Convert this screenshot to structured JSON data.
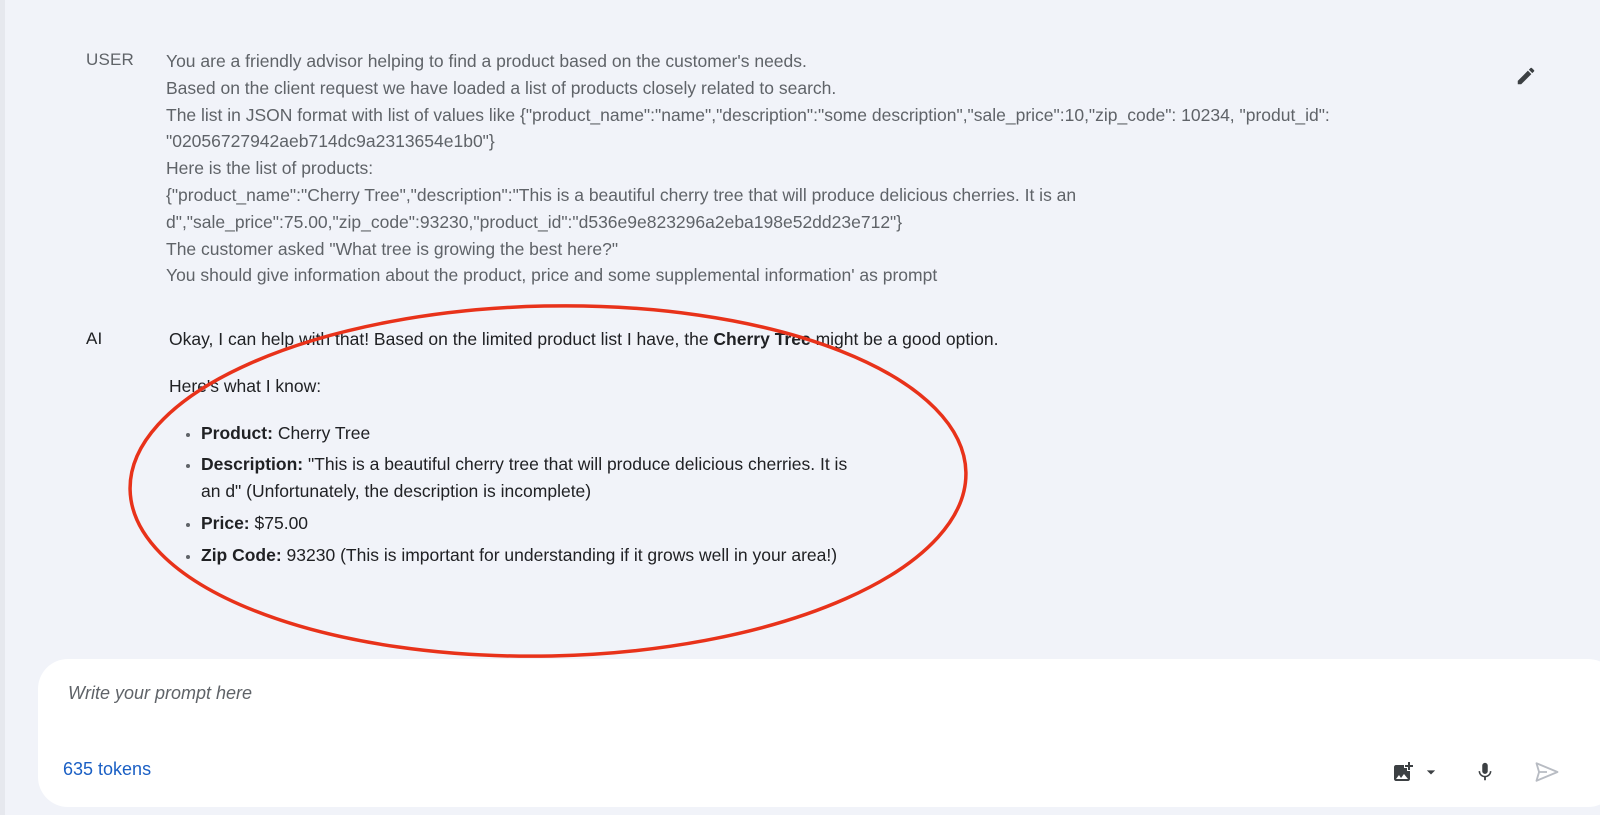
{
  "conversation": {
    "user": {
      "role_label": "USER",
      "lines": [
        "You are a friendly advisor helping to find a product based on the customer's needs.",
        "Based on the client request we have loaded a list of products closely related to search.",
        "The list in JSON format with list of values like {\"product_name\":\"name\",\"description\":\"some description\",\"sale_price\":10,\"zip_code\": 10234, \"produt_id\":",
        "\"02056727942aeb714dc9a2313654e1b0\"}",
        "Here is the list of products:",
        "{\"product_name\":\"Cherry Tree\",\"description\":\"This is a beautiful cherry tree that will produce delicious cherries. It is an",
        "d\",\"sale_price\":75.00,\"zip_code\":93230,\"product_id\":\"d536e9e823296a2eba198e52dd23e712\"}",
        "The customer asked \"What tree is growing the best here?\"",
        "You should give information about the product, price and some supplemental information' as prompt"
      ]
    },
    "ai": {
      "role_label": "AI",
      "intro_before": "Okay, I can help with that! Based on the limited product list I have, the ",
      "intro_bold": "Cherry Tree",
      "intro_after": " might be a good option.",
      "subheading": "Here's what I know:",
      "items": [
        {
          "label": "Product:",
          "value": " Cherry Tree"
        },
        {
          "label": "Description:",
          "value": " \"This is a beautiful cherry tree that will produce delicious cherries. It is an d\" (Unfortunately, the description is incomplete)"
        },
        {
          "label": "Price:",
          "value": " $75.00"
        },
        {
          "label": "Zip Code:",
          "value": " 93230 (This is important for understanding if it grows well in your area!)"
        }
      ]
    }
  },
  "composer": {
    "placeholder": "Write your prompt here",
    "token_count": "635 tokens"
  },
  "icons": {
    "edit": "pencil-icon",
    "image": "add-image-icon",
    "dropdown": "caret-down-icon",
    "mic": "microphone-icon",
    "send": "send-icon"
  },
  "colors": {
    "background": "#f1f3f9",
    "annotation": "#e8321a",
    "token_link": "#1a5fc4"
  }
}
